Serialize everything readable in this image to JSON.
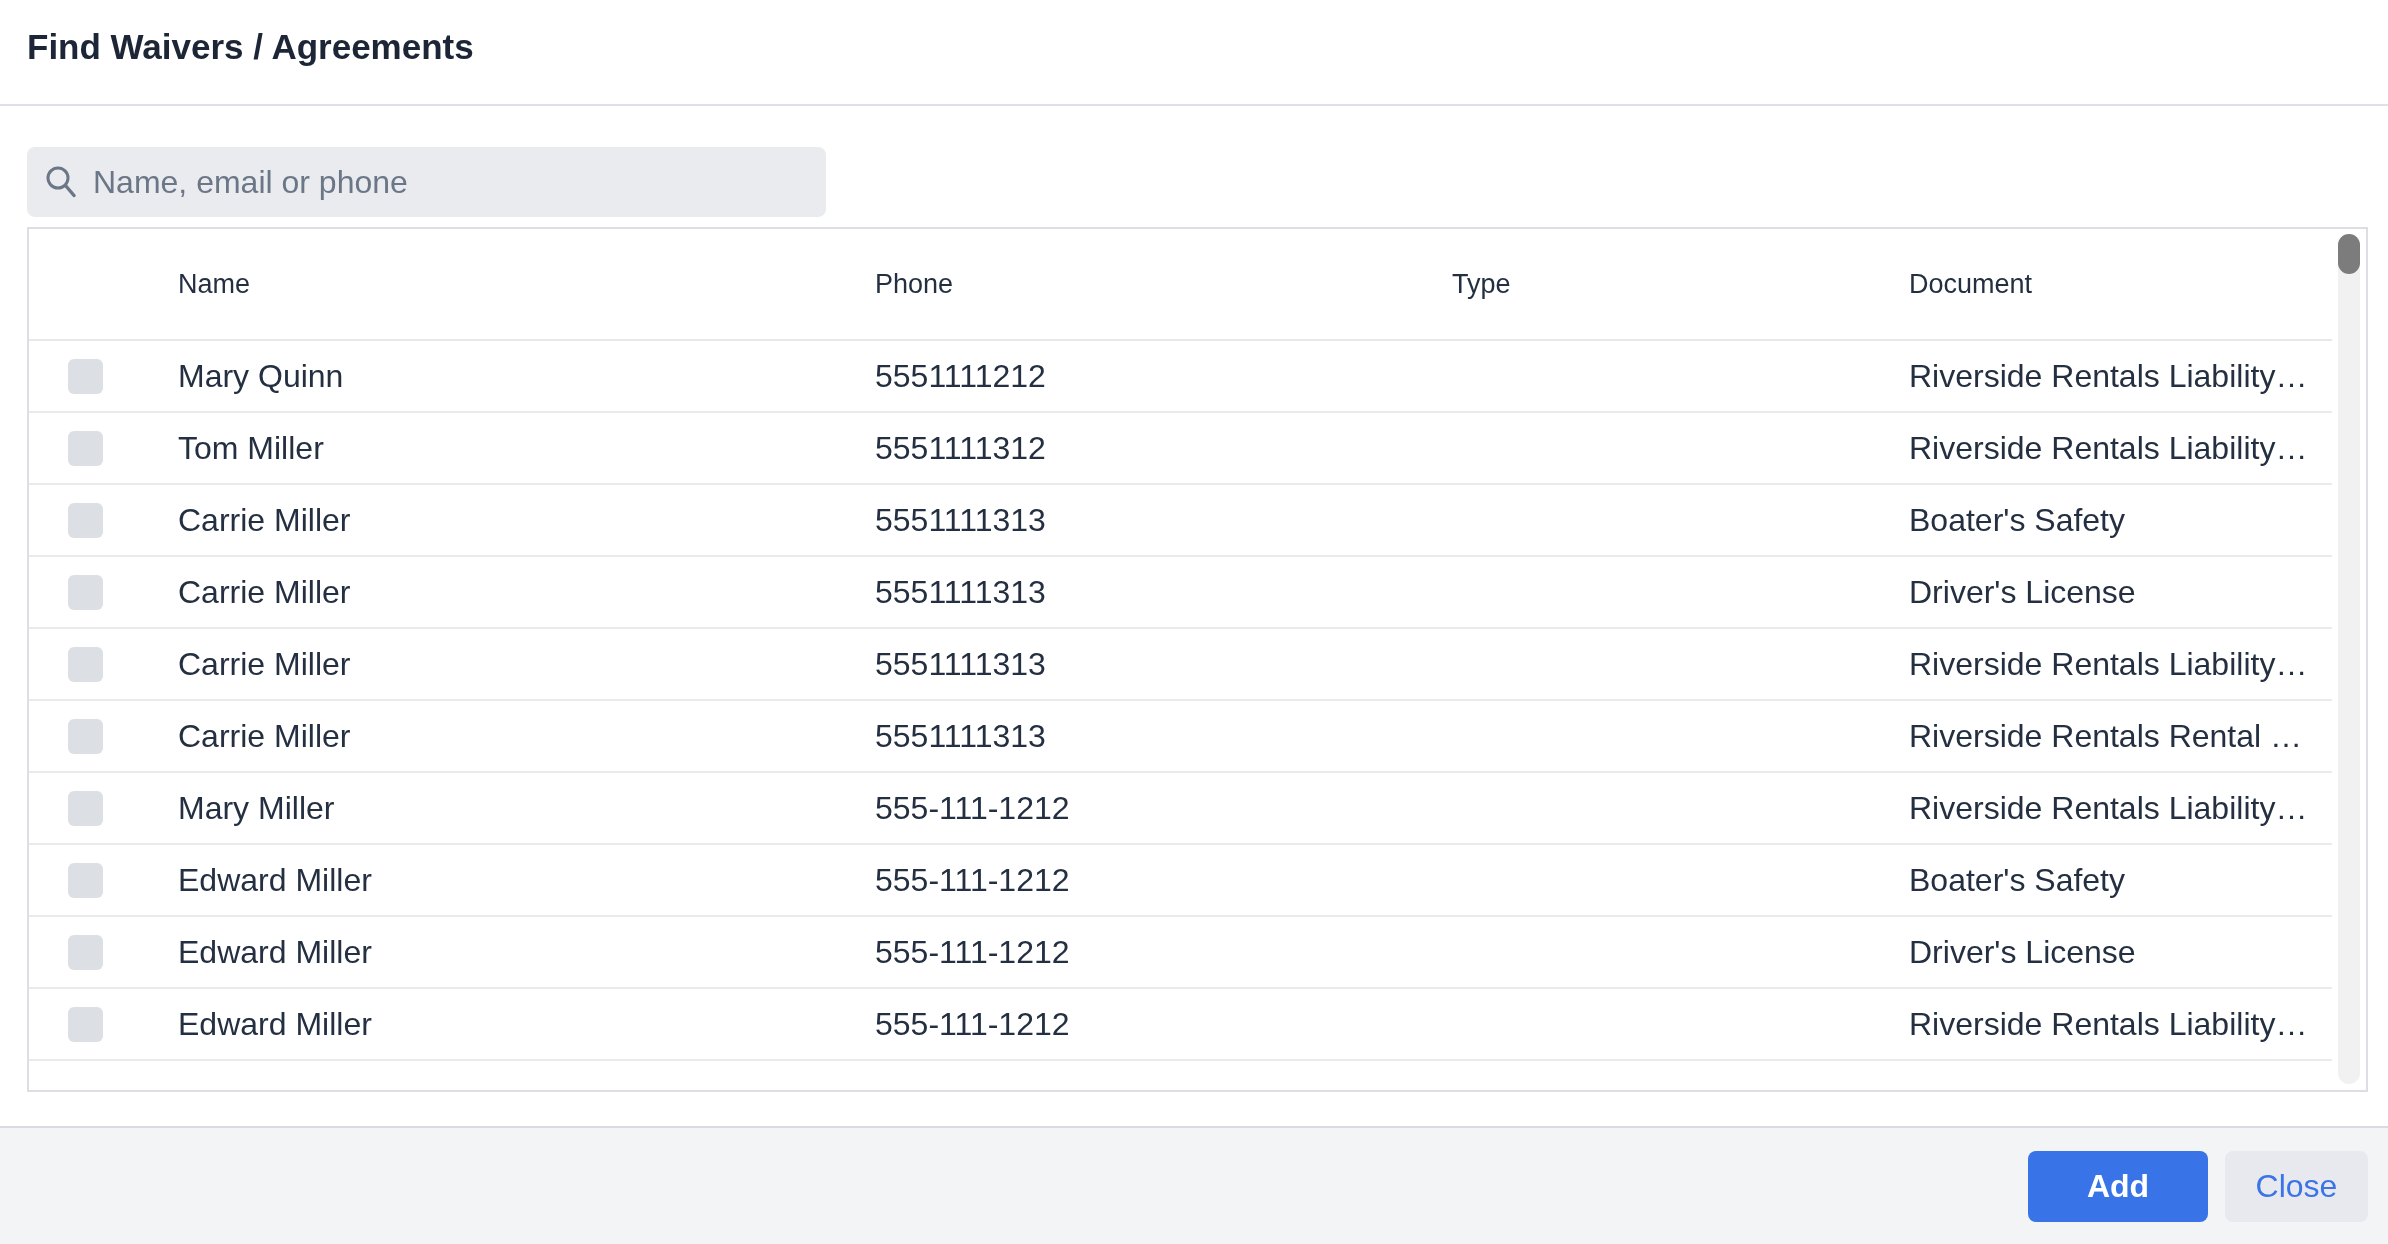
{
  "dialog": {
    "title": "Find Waivers / Agreements"
  },
  "search": {
    "placeholder": "Name, email or phone"
  },
  "table": {
    "columns": [
      "Name",
      "Phone",
      "Type",
      "Document"
    ],
    "rows": [
      {
        "checked": false,
        "name": "Mary Quinn",
        "phone": "5551111212",
        "document": "Riverside Rentals Liability…"
      },
      {
        "checked": false,
        "name": "Tom Miller",
        "phone": "5551111312",
        "document": "Riverside Rentals Liability…"
      },
      {
        "checked": false,
        "name": "Carrie Miller",
        "phone": "5551111313",
        "document": "Boater's Safety"
      },
      {
        "checked": false,
        "name": "Carrie Miller",
        "phone": "5551111313",
        "document": "Driver's License"
      },
      {
        "checked": false,
        "name": "Carrie Miller",
        "phone": "5551111313",
        "document": "Riverside Rentals Liability…"
      },
      {
        "checked": false,
        "name": "Carrie Miller",
        "phone": "5551111313",
        "document": "Riverside Rentals Rental …"
      },
      {
        "checked": false,
        "name": "Mary Miller",
        "phone": "555-111-1212",
        "document": "Riverside Rentals Liability…"
      },
      {
        "checked": false,
        "name": "Edward Miller",
        "phone": "555-111-1212",
        "document": "Boater's Safety"
      },
      {
        "checked": false,
        "name": "Edward Miller",
        "phone": "555-111-1212",
        "document": "Driver's License"
      },
      {
        "checked": false,
        "name": "Edward Miller",
        "phone": "555-111-1212",
        "document": "Riverside Rentals Liability…"
      }
    ]
  },
  "buttons": [
    {
      "label": "Add",
      "kind": "primary"
    },
    {
      "label": "Close",
      "kind": "secondary"
    }
  ]
}
